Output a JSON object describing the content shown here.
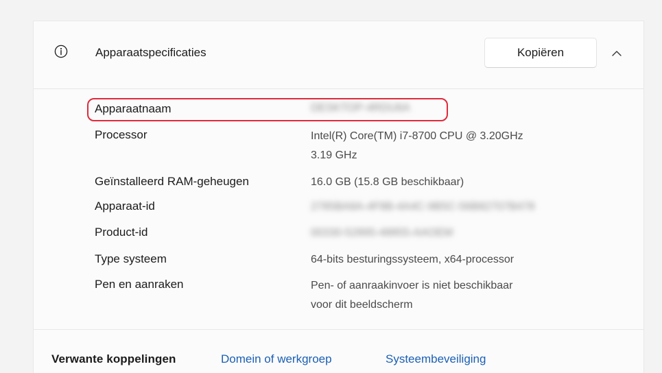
{
  "header": {
    "title": "Apparaatspecificaties",
    "copy_label": "Kopiëren"
  },
  "specs": [
    {
      "label": "Apparaatnaam",
      "value": "DESKTOP-4RDU6A",
      "blurred": true
    },
    {
      "label": "Processor",
      "value": "Intel(R) Core(TM) i7-8700 CPU @ 3.20GHz",
      "value2": "3.19 GHz"
    },
    {
      "label": "Geïnstalleerd RAM-geheugen",
      "value": "16.0 GB (15.8 GB beschikbaar)"
    },
    {
      "label": "Apparaat-id",
      "value": "2785BA8A-4F8B-4A4C-9B5C-56B82707B478",
      "blurred": true
    },
    {
      "label": "Product-id",
      "value": "00330-52895-48855-AAOEM",
      "blurred": true
    },
    {
      "label": "Type systeem",
      "value": "64-bits besturingssysteem, x64-processor"
    },
    {
      "label": "Pen en aanraken",
      "value": "Pen- of aanraakinvoer is niet beschikbaar",
      "value2": "voor dit beeldscherm"
    }
  ],
  "related": {
    "title": "Verwante koppelingen",
    "links": [
      "Domein of werkgroep",
      "Systeembeveiliging"
    ]
  },
  "colors": {
    "accent_link": "#1a5fb4",
    "highlight": "#e0293a"
  },
  "icons": {
    "info": "info-circle-icon",
    "collapse": "chevron-up-icon"
  }
}
